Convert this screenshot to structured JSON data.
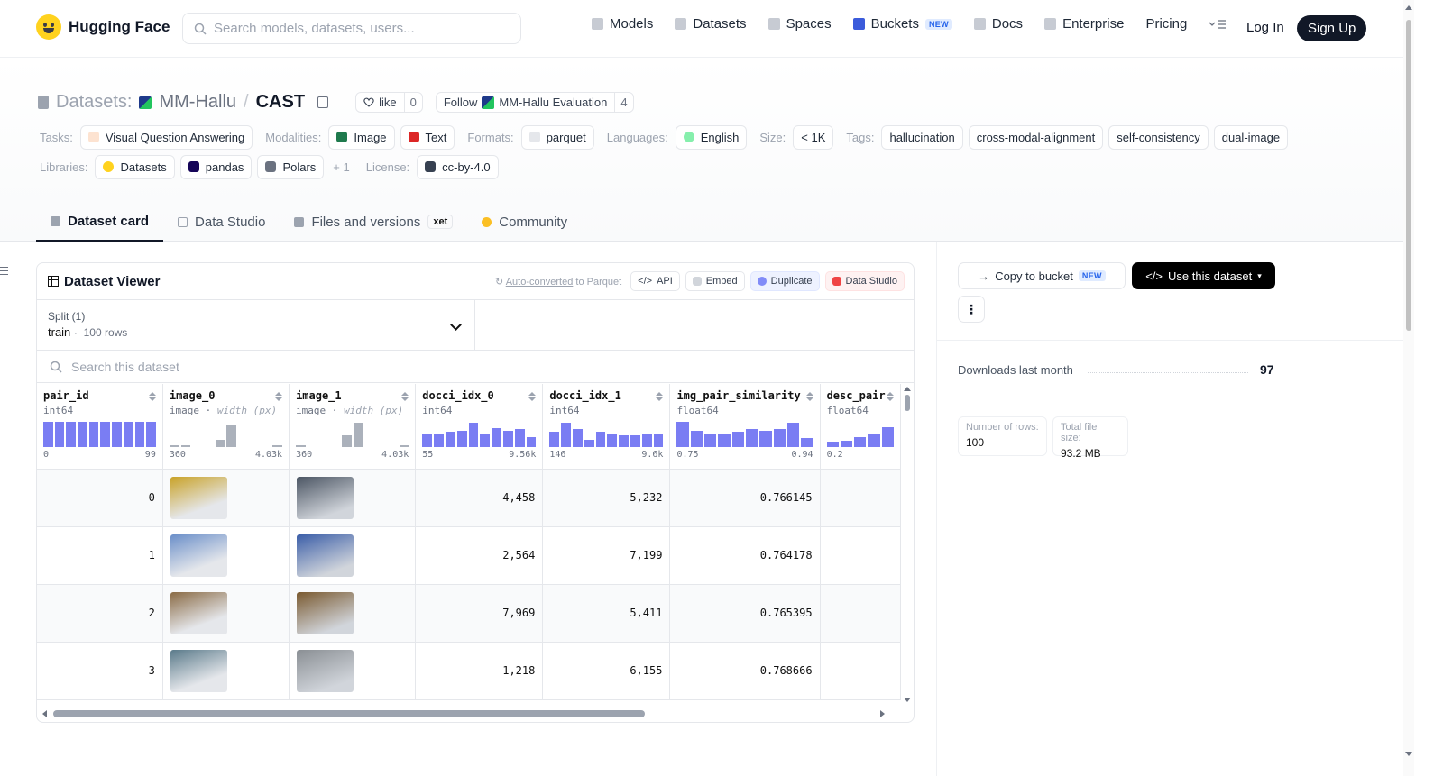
{
  "nav": {
    "brand": "Hugging Face",
    "search_placeholder": "Search models, datasets, users...",
    "links": [
      {
        "label": "Models",
        "icon": "cube-icon"
      },
      {
        "label": "Datasets",
        "icon": "database-icon"
      },
      {
        "label": "Spaces",
        "icon": "grid-icon"
      },
      {
        "label": "Buckets",
        "icon": "bucket-icon",
        "badge": "NEW"
      },
      {
        "label": "Docs",
        "icon": "book-icon"
      },
      {
        "label": "Enterprise",
        "icon": "enterprise-icon"
      },
      {
        "label": "Pricing"
      }
    ],
    "login": "Log In",
    "signup": "Sign Up"
  },
  "header": {
    "prefix": "Datasets:",
    "org": "MM-Hallu",
    "separator": "/",
    "name": "CAST",
    "like_label": "like",
    "like_count": "0",
    "follow_label": "Follow",
    "follow_org": "MM-Hallu Evaluation",
    "follow_count": "4"
  },
  "tags": {
    "tasks_label": "Tasks:",
    "tasks": [
      "Visual Question Answering"
    ],
    "modalities_label": "Modalities:",
    "modalities": [
      "Image",
      "Text"
    ],
    "formats_label": "Formats:",
    "formats": [
      "parquet"
    ],
    "languages_label": "Languages:",
    "languages": [
      "English"
    ],
    "size_label": "Size:",
    "size": "< 1K",
    "tags_label": "Tags:",
    "tags": [
      "hallucination",
      "cross-modal-alignment",
      "self-consistency",
      "dual-image"
    ],
    "libraries_label": "Libraries:",
    "libraries": [
      "Datasets",
      "pandas",
      "Polars"
    ],
    "libraries_more": "+ 1",
    "license_label": "License:",
    "license": "cc-by-4.0"
  },
  "tabs": [
    {
      "label": "Dataset card",
      "active": true
    },
    {
      "label": "Data Studio"
    },
    {
      "label": "Files and versions",
      "badge": "xet"
    },
    {
      "label": "Community"
    }
  ],
  "viewer": {
    "title": "Dataset Viewer",
    "auto_converted": "Auto-converted",
    "to_parquet": "to Parquet",
    "api": "API",
    "embed": "Embed",
    "duplicate": "Duplicate",
    "data_studio": "Data Studio",
    "split_label": "Split (1)",
    "split_value": "train",
    "split_rows": "100 rows",
    "search_placeholder": "Search this dataset",
    "columns": [
      {
        "name": "pair_id",
        "type": "int64",
        "min": "0",
        "max": "99",
        "hist": [
          1,
          1,
          1,
          1,
          1,
          1,
          1,
          1,
          1,
          1
        ]
      },
      {
        "name": "image_0",
        "type": "image",
        "type_extra": "width (px)",
        "min": "360",
        "max": "4.03k",
        "hist": [
          0.05,
          0.05,
          0,
          0,
          0.3,
          0.9,
          0,
          0,
          0,
          0.05
        ]
      },
      {
        "name": "image_1",
        "type": "image",
        "type_extra": "width (px)",
        "min": "360",
        "max": "4.03k",
        "hist": [
          0.05,
          0,
          0,
          0,
          0.45,
          0.95,
          0,
          0,
          0,
          0.05
        ]
      },
      {
        "name": "docci_idx_0",
        "type": "int64",
        "min": "55",
        "max": "9.56k",
        "hist": [
          0.55,
          0.5,
          0.6,
          0.65,
          0.95,
          0.5,
          0.75,
          0.65,
          0.7,
          0.4
        ]
      },
      {
        "name": "docci_idx_1",
        "type": "int64",
        "min": "146",
        "max": "9.6k",
        "hist": [
          0.6,
          0.95,
          0.7,
          0.3,
          0.6,
          0.5,
          0.45,
          0.45,
          0.55,
          0.5
        ]
      },
      {
        "name": "img_pair_similarity",
        "type": "float64",
        "min": "0.75",
        "max": "0.94",
        "hist": [
          1,
          0.65,
          0.5,
          0.55,
          0.6,
          0.7,
          0.65,
          0.7,
          0.95,
          0.35
        ]
      },
      {
        "name": "desc_pair",
        "type": "float64",
        "min": "0.2",
        "max": "",
        "hist": [
          0.2,
          0.25,
          0.4,
          0.55,
          0.8
        ]
      }
    ],
    "rows": [
      {
        "pair_id": "0",
        "docci_idx_0": "4,458",
        "docci_idx_1": "5,232",
        "img_pair_similarity": "0.766145"
      },
      {
        "pair_id": "1",
        "docci_idx_0": "2,564",
        "docci_idx_1": "7,199",
        "img_pair_similarity": "0.764178"
      },
      {
        "pair_id": "2",
        "docci_idx_0": "7,969",
        "docci_idx_1": "5,411",
        "img_pair_similarity": "0.765395"
      },
      {
        "pair_id": "3",
        "docci_idx_0": "1,218",
        "docci_idx_1": "6,155",
        "img_pair_similarity": "0.768666"
      }
    ]
  },
  "sidebar": {
    "copy_to_bucket": "Copy to bucket",
    "copy_badge": "NEW",
    "use_dataset": "Use this dataset",
    "downloads_label": "Downloads last month",
    "downloads": "97",
    "rows_label": "Number of rows:",
    "rows_value": "100",
    "size_label": "Total file size:",
    "size_value": "93.2 MB"
  },
  "colors": {
    "hist_bar": "#6366f1",
    "primary_dark": "#111827"
  }
}
